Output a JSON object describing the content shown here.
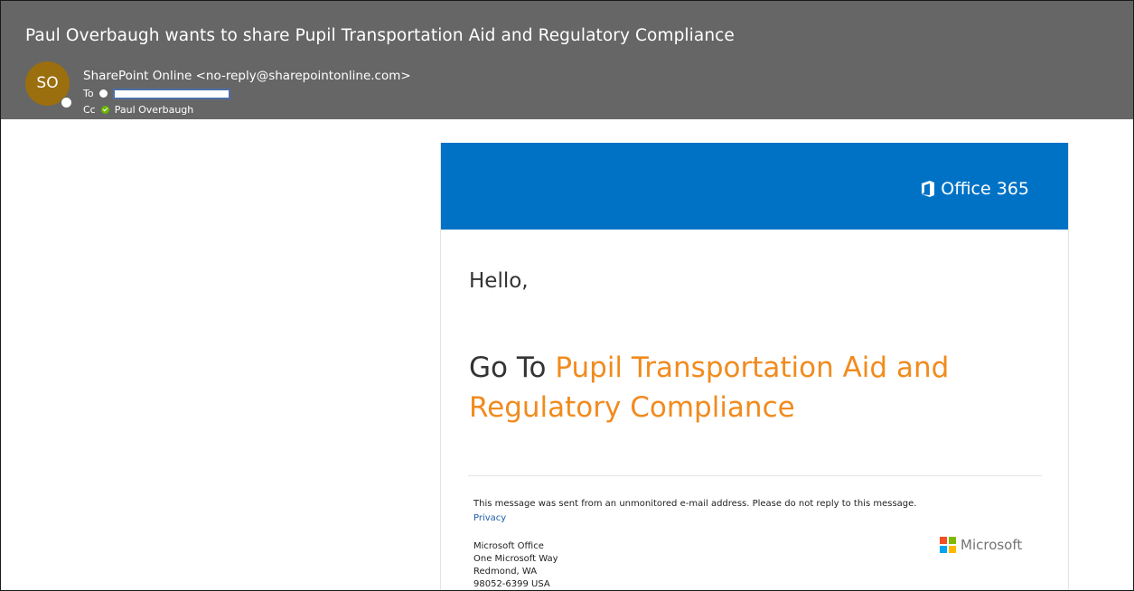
{
  "email": {
    "subject": "Paul Overbaugh wants to share Pupil Transportation Aid and Regulatory Compliance",
    "avatar_initials": "SO",
    "sender": "SharePoint Online <no-reply@sharepointonline.com>",
    "to_label": "To",
    "cc_label": "Cc",
    "cc_name": "Paul Overbaugh"
  },
  "body": {
    "brand": "Office 365",
    "greeting": "Hello,",
    "goto_prefix": "Go To",
    "goto_link": "Pupil Transportation Aid and Regulatory Compliance",
    "notice": "This message was sent from an unmonitored e-mail address. Please do not reply to this message.",
    "privacy": "Privacy",
    "address": [
      "Microsoft Office",
      "One Microsoft Way",
      "Redmond, WA",
      "98052-6399 USA"
    ],
    "ms_brand": "Microsoft"
  },
  "colors": {
    "header_bg": "#666666",
    "avatar_bg": "#9b6e0e",
    "banner_bg": "#0072c6",
    "link_orange": "#f18b1e"
  },
  "icons": [
    "office-logo-icon",
    "microsoft-logo-icon",
    "presence-icon",
    "verified-icon"
  ]
}
